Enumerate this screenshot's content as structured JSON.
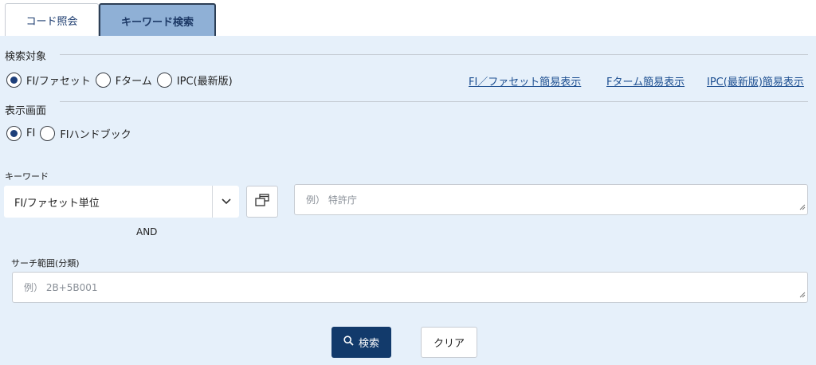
{
  "tabs": [
    {
      "label": "コード照会"
    },
    {
      "label": "キーワード検索"
    }
  ],
  "search_target": {
    "title": "検索対象",
    "options": [
      {
        "label": "FI/ファセット",
        "selected": true
      },
      {
        "label": "Fターム",
        "selected": false
      },
      {
        "label": "IPC(最新版)",
        "selected": false
      }
    ],
    "links": [
      "FI／ファセット簡易表示",
      "Fターム簡易表示",
      "IPC(最新版)簡易表示"
    ]
  },
  "display_screen": {
    "title": "表示画面",
    "options": [
      {
        "label": "FI",
        "selected": true
      },
      {
        "label": "FIハンドブック",
        "selected": false
      }
    ]
  },
  "keyword": {
    "label": "キーワード",
    "unit_select_value": "FI/ファセット単位",
    "placeholder": "例） 特許庁",
    "operator": "AND"
  },
  "search_range": {
    "label": "サーチ範囲(分類)",
    "placeholder": "例） 2B+5B001"
  },
  "buttons": {
    "search": "検索",
    "clear": "クリア"
  },
  "colors": {
    "panel_bg": "#e6f0fa",
    "active_tab_bg": "#8fb0d6",
    "primary": "#123a6b",
    "link": "#1d4f91"
  }
}
